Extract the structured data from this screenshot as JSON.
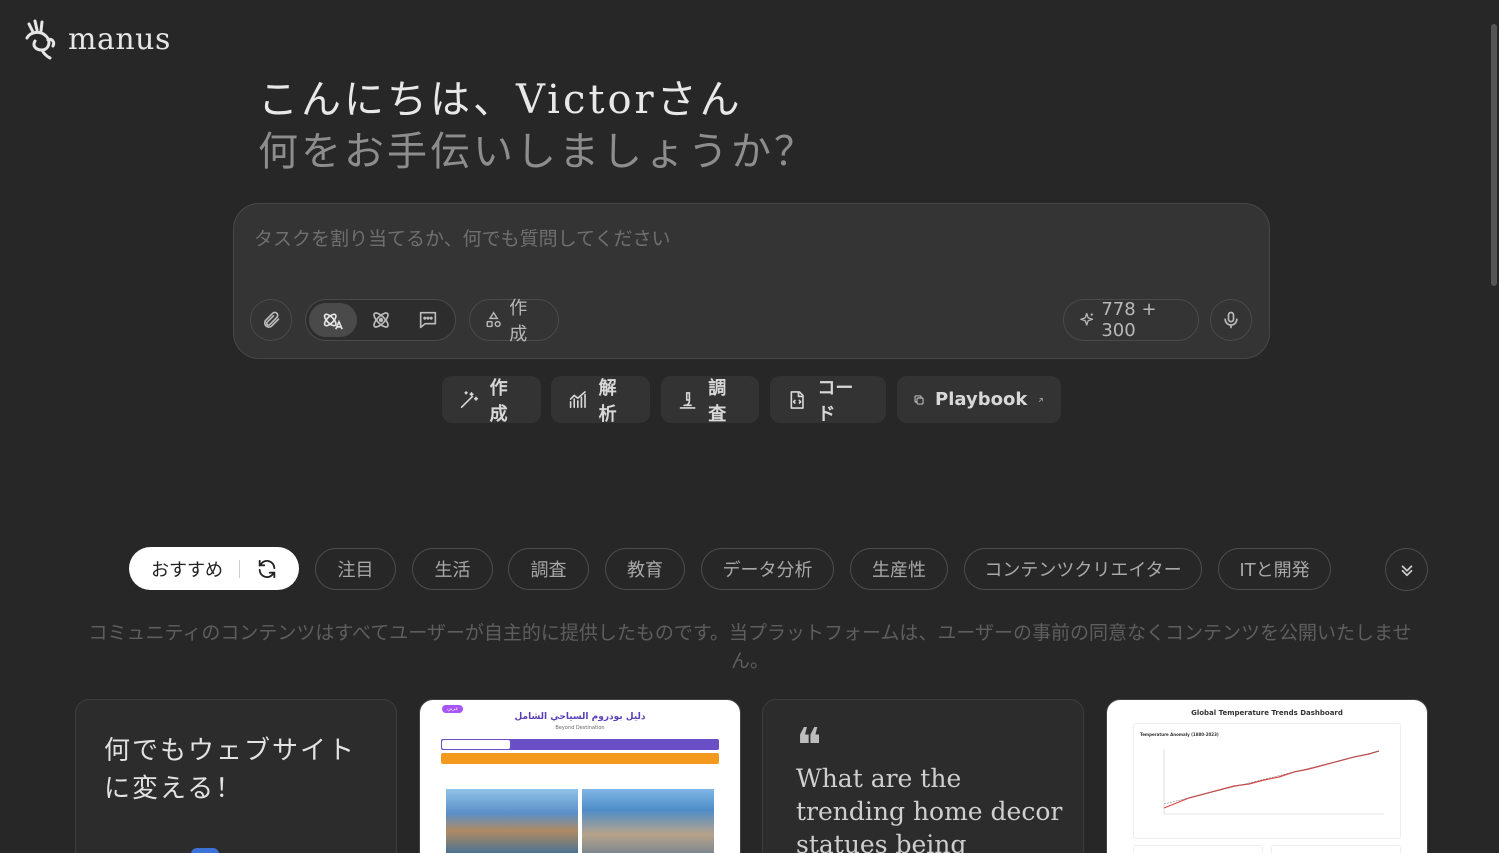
{
  "app": {
    "logo_text": "manus"
  },
  "greeting": {
    "line1": "こんにちは、Victorさん",
    "line2": "何をお手伝いしましょうか？"
  },
  "composer": {
    "placeholder": "タスクを割り当てるか、何でも質問してください",
    "create_label": "作成",
    "credits_label": "778 + 300"
  },
  "quick_actions": [
    {
      "label": "作成",
      "icon": "magic-wand-icon"
    },
    {
      "label": "解析",
      "icon": "chart-icon"
    },
    {
      "label": "調査",
      "icon": "microscope-icon"
    },
    {
      "label": "コード",
      "icon": "code-file-icon"
    },
    {
      "label": "Playbook",
      "icon": "copy-icon"
    }
  ],
  "categories": {
    "active": "おすすめ",
    "items": [
      "注目",
      "生活",
      "調査",
      "教育",
      "データ分析",
      "生産性",
      "コンテンツクリエイター",
      "ITと開発"
    ]
  },
  "disclaimer": "コミュニティのコンテンツはすべてユーザーが自主的に提供したものです。当プラットフォームは、ユーザーの事前の同意なくコンテンツを公開いたしません。",
  "cards": [
    {
      "type": "text",
      "title": "何でもウェブサイトに変える！"
    },
    {
      "type": "preview",
      "title": "دليل بودروم السياحي الشامل",
      "subtitle": "Beyond Destination",
      "badge": "عربي"
    },
    {
      "type": "quote",
      "text": "What are the trending home decor statues being searched for"
    },
    {
      "type": "preview",
      "title": "Global Temperature Trends Dashboard",
      "subtitle": "Temperature Anomaly (1880-2023)"
    }
  ],
  "colors": {
    "background": "#272727",
    "surface": "#343434",
    "accent_badge": "#a855f7",
    "nav_purple": "#6a4fc7",
    "nav_orange": "#f39a1e"
  }
}
